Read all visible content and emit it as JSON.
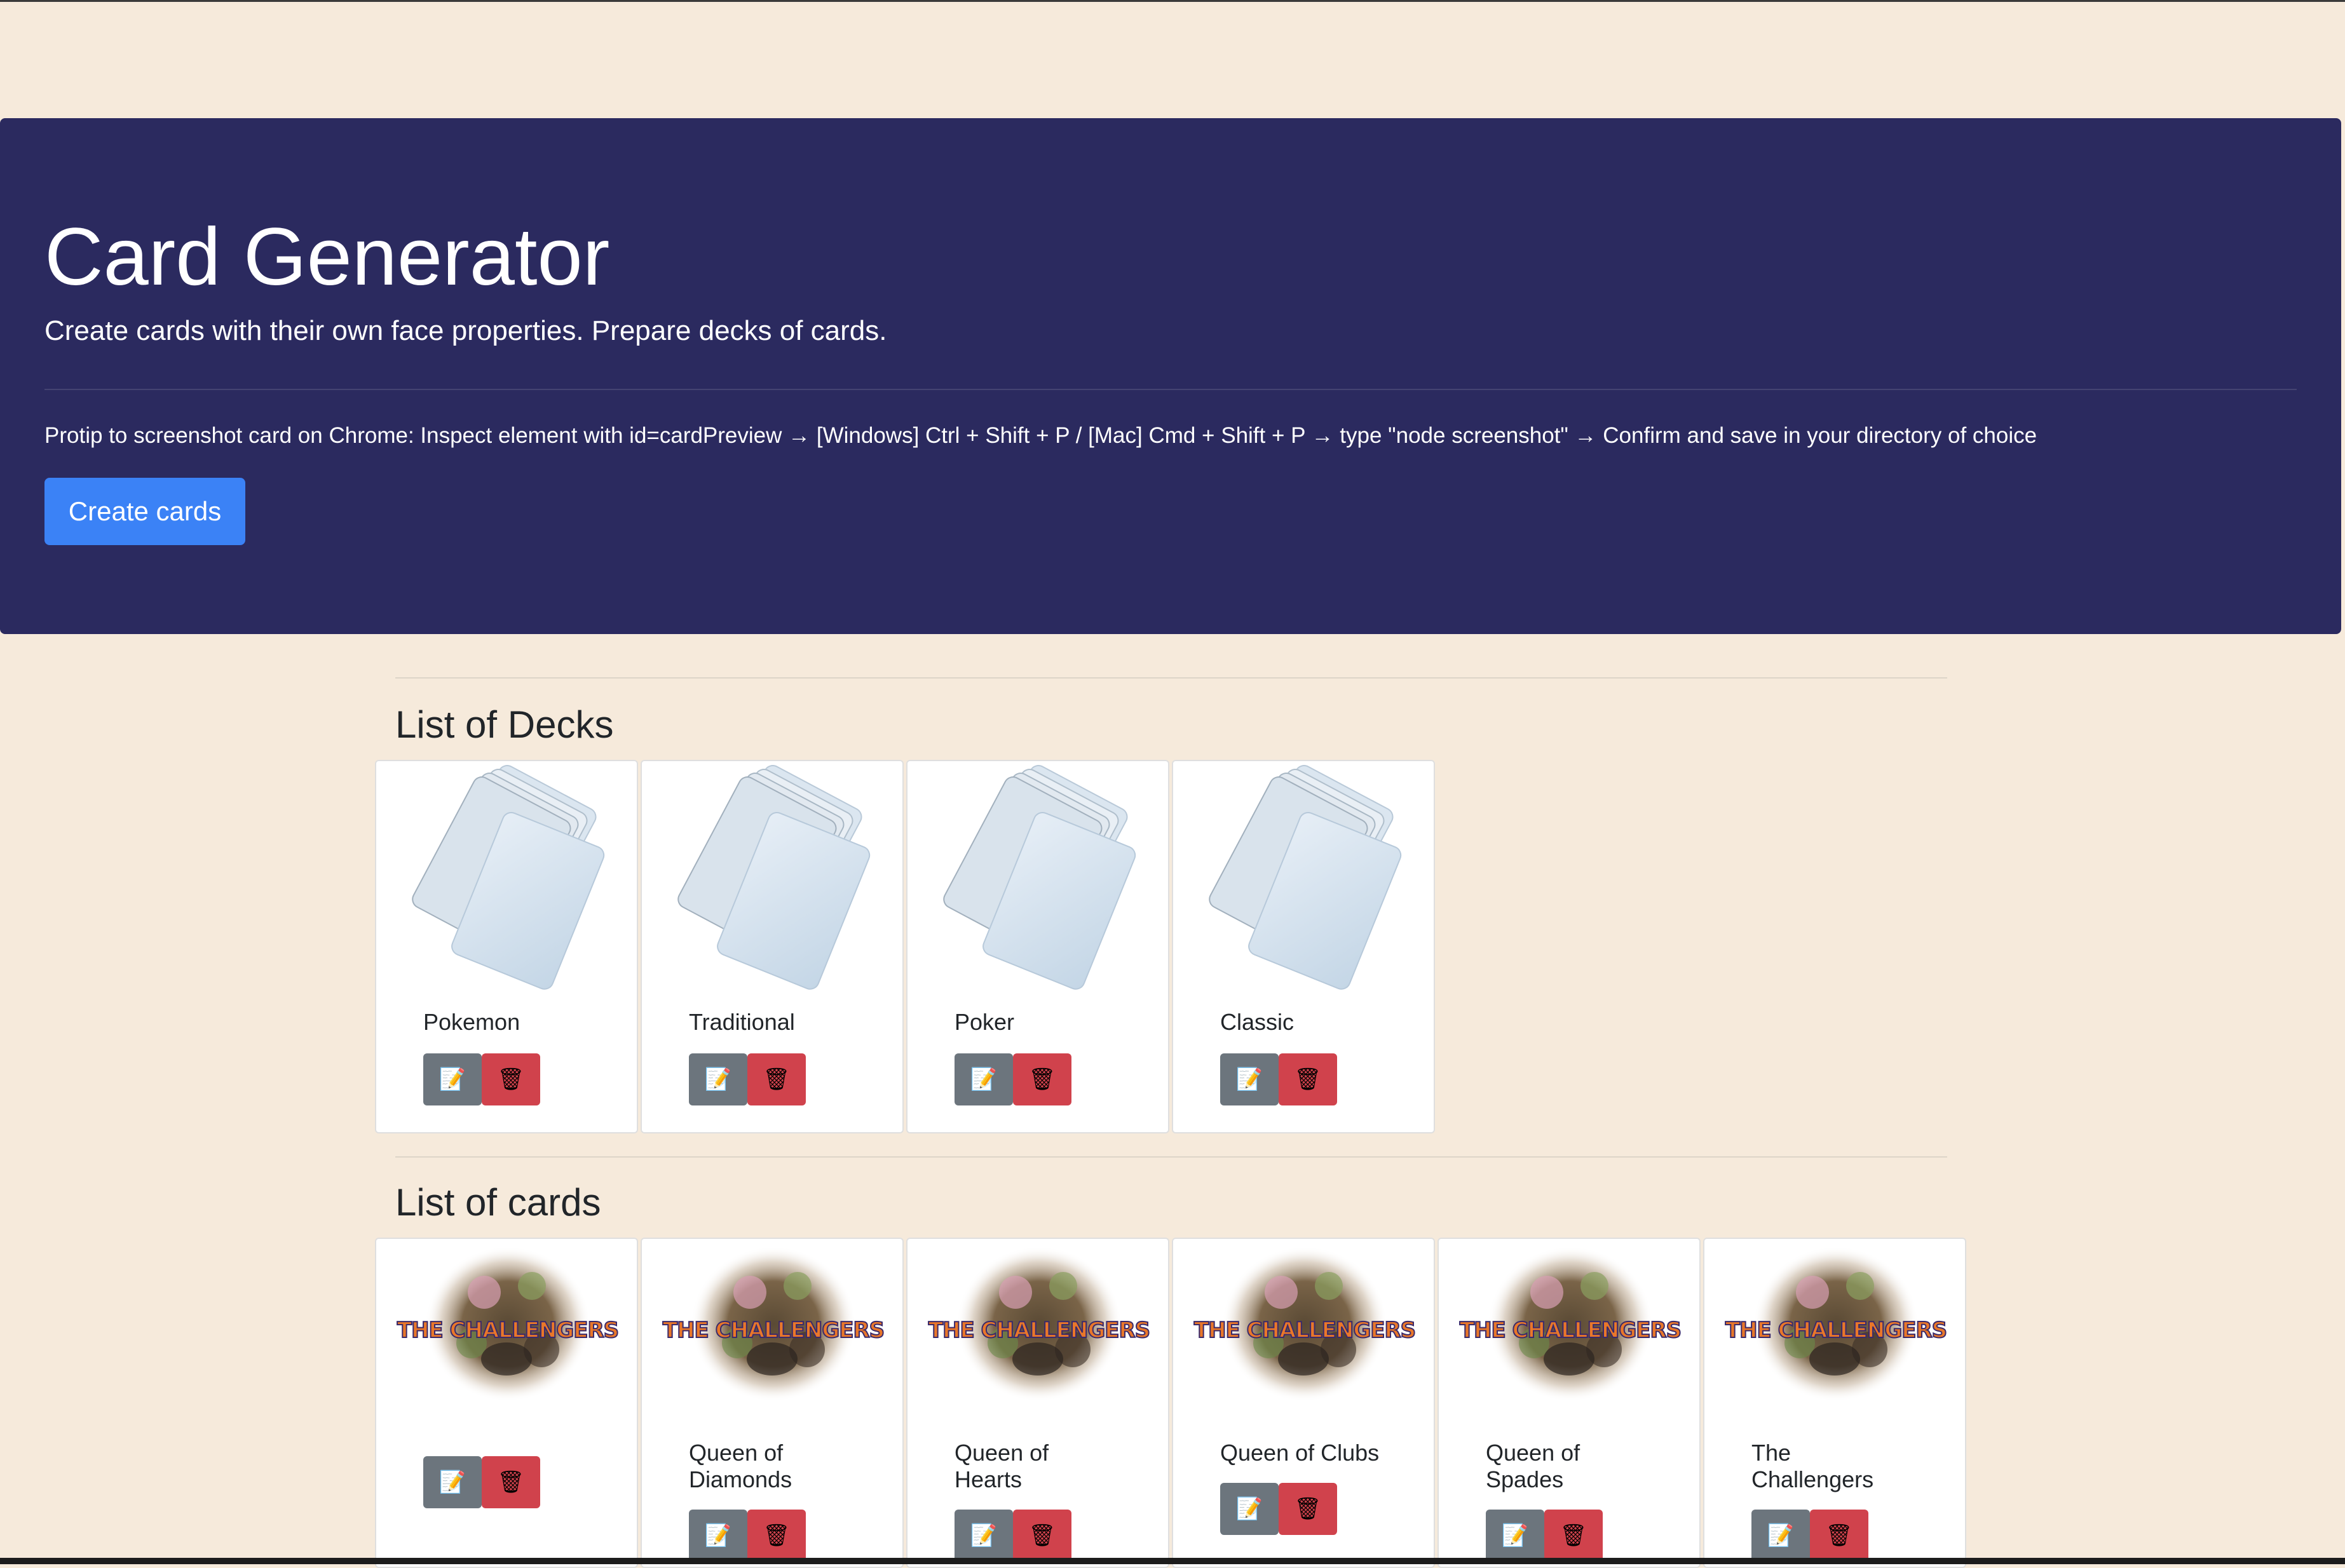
{
  "header": {
    "title": "Card Generator",
    "subtitle": "Create cards with their own face properties. Prepare decks of cards.",
    "protip": "Protip to screenshot card on Chrome: Inspect element with id=cardPreview → [Windows] Ctrl + Shift + P / [Mac] Cmd + Shift + P → type \"node screenshot\" → Confirm and save in your directory of choice",
    "create_button": "Create cards"
  },
  "decks": {
    "heading": "List of Decks",
    "items": [
      {
        "name": "Pokemon"
      },
      {
        "name": "Traditional"
      },
      {
        "name": "Poker"
      },
      {
        "name": "Classic"
      }
    ]
  },
  "cards": {
    "heading": "List of cards",
    "image_text": "THE CHALLENGERS",
    "items": [
      {
        "name": ""
      },
      {
        "name": "Queen of Diamonds"
      },
      {
        "name": "Queen of Hearts"
      },
      {
        "name": "Queen of Clubs"
      },
      {
        "name": "Queen of Spades"
      },
      {
        "name": "The Challengers"
      }
    ]
  },
  "icons": {
    "edit": "memo-pencil-icon",
    "delete": "trash-can-icon"
  },
  "colors": {
    "page_bg": "#f6eadb",
    "jumbotron_bg": "#2b2a5f",
    "primary": "#3b82f6",
    "secondary": "#6c757d",
    "danger": "#d0424c"
  }
}
